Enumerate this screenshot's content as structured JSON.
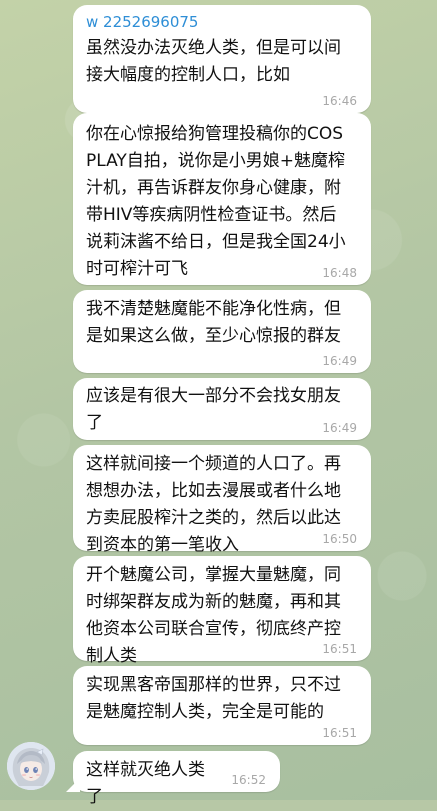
{
  "sender": {
    "name": "w 2252696075"
  },
  "messages": [
    {
      "text": "虽然没办法灭绝人类，但是可以间接大幅度的控制人口，比如",
      "time": "16:46"
    },
    {
      "text": "你在心惊报给狗管理投稿你的COSPLAY自拍，说你是小男娘+魅魔榨汁机，再告诉群友你身心健康，附带HIV等疾病阴性检查证书。然后说莉沫酱不给日，但是我全国24小时可榨汁可飞",
      "time": "16:48"
    },
    {
      "text": "我不清楚魅魔能不能净化性病，但是如果这么做，至少心惊报的群友",
      "time": "16:49"
    },
    {
      "text": "应该是有很大一部分不会找女朋友了",
      "time": "16:49"
    },
    {
      "text": "这样就间接一个频道的人口了。再想想办法，比如去漫展或者什么地方卖屁股榨汁之类的，然后以此达到资本的第一笔收入",
      "time": "16:50"
    },
    {
      "text": "开个魅魔公司，掌握大量魅魔，同时绑架群友成为新的魅魔，再和其他资本公司联合宣传，彻底终产控制人类",
      "time": "16:51"
    },
    {
      "text": "实现黑客帝国那样的世界，只不过是魅魔控制人类，完全是可能的",
      "time": "16:51"
    },
    {
      "text": "这样就灭绝人类了",
      "time": "16:52"
    }
  ],
  "colors": {
    "sender_name": "#2e8ed6",
    "bubble": "#ffffff",
    "time": "#a8a8a8"
  },
  "icons": {
    "avatar": "anime-girl-avatar"
  }
}
